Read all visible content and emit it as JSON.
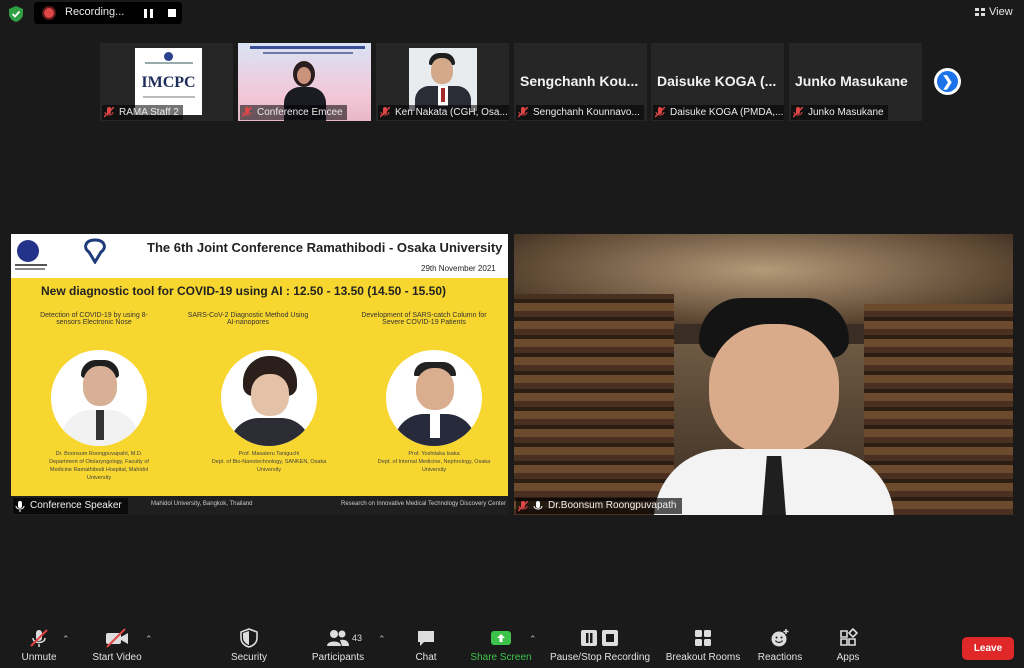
{
  "recording": {
    "label": "Recording..."
  },
  "view": {
    "label": "View"
  },
  "participants_strip": [
    {
      "tile_text": "IMCPC",
      "name": "RAMA Staff 2"
    },
    {
      "tile_text": "",
      "name": "Conference Emcee"
    },
    {
      "tile_text": "",
      "name": "Ken Nakata (CGH, Osa..."
    },
    {
      "tile_text": "Sengchanh Kou...",
      "name": "Sengchanh Kounnavo..."
    },
    {
      "tile_text": "Daisuke KOGA (...",
      "name": "Daisuke KOGA (PMDA,..."
    },
    {
      "tile_text": "Junko Masukane",
      "name": "Junko Masukane"
    }
  ],
  "slide": {
    "title": "The 6th Joint Conference Ramathibodi - Osaka University",
    "date": "29th November  2021",
    "session": "New diagnostic tool for COVID-19 using AI : 12.50 - 13.50 (14.50 - 15.50)",
    "talks": [
      {
        "title": "Detection of COVID-19 by using 8-sensors Electronic Nose",
        "speaker": "Dr. Boonsum Roongpuvapaht, M.D.",
        "affil": "Department of Otolaryngology, Faculty of Medicine Ramathibodi Hospital, Mahidol University"
      },
      {
        "title": "SARS-CoV-2 Diagnostic Method Using AI-nanopores",
        "speaker": "Prof. Masateru Taniguchi",
        "affil": "Dept. of Bio-Nanotechnology, SANKEN, Osaka University"
      },
      {
        "title": "Development of SARS-catch Column for Severe COVID-19 Patients",
        "speaker": "Prof. Yoshitaka Isaka",
        "affil": "Dept. of Internal Medicine, Nephrology, Osaka University"
      }
    ],
    "footer_left": "Mahidol University, Bangkok, Thailand",
    "footer_right": "Research on Innovative Medical Technology Discovery Center"
  },
  "panes": {
    "left_name": "Conference Speaker",
    "right_name": "Dr.Boonsum Roongpuvapath"
  },
  "toolbar": {
    "unmute": "Unmute",
    "start_video": "Start Video",
    "security": "Security",
    "participants": "Participants",
    "participants_count": "43",
    "chat": "Chat",
    "share_screen": "Share Screen",
    "pause_stop": "Pause/Stop Recording",
    "breakout": "Breakout Rooms",
    "reactions": "Reactions",
    "apps": "Apps",
    "leave": "Leave"
  },
  "colors": {
    "accent_green": "#3ec34a",
    "leave_red": "#e02828",
    "slide_yellow": "#f7d62f",
    "next_blue": "#1a73e8"
  }
}
